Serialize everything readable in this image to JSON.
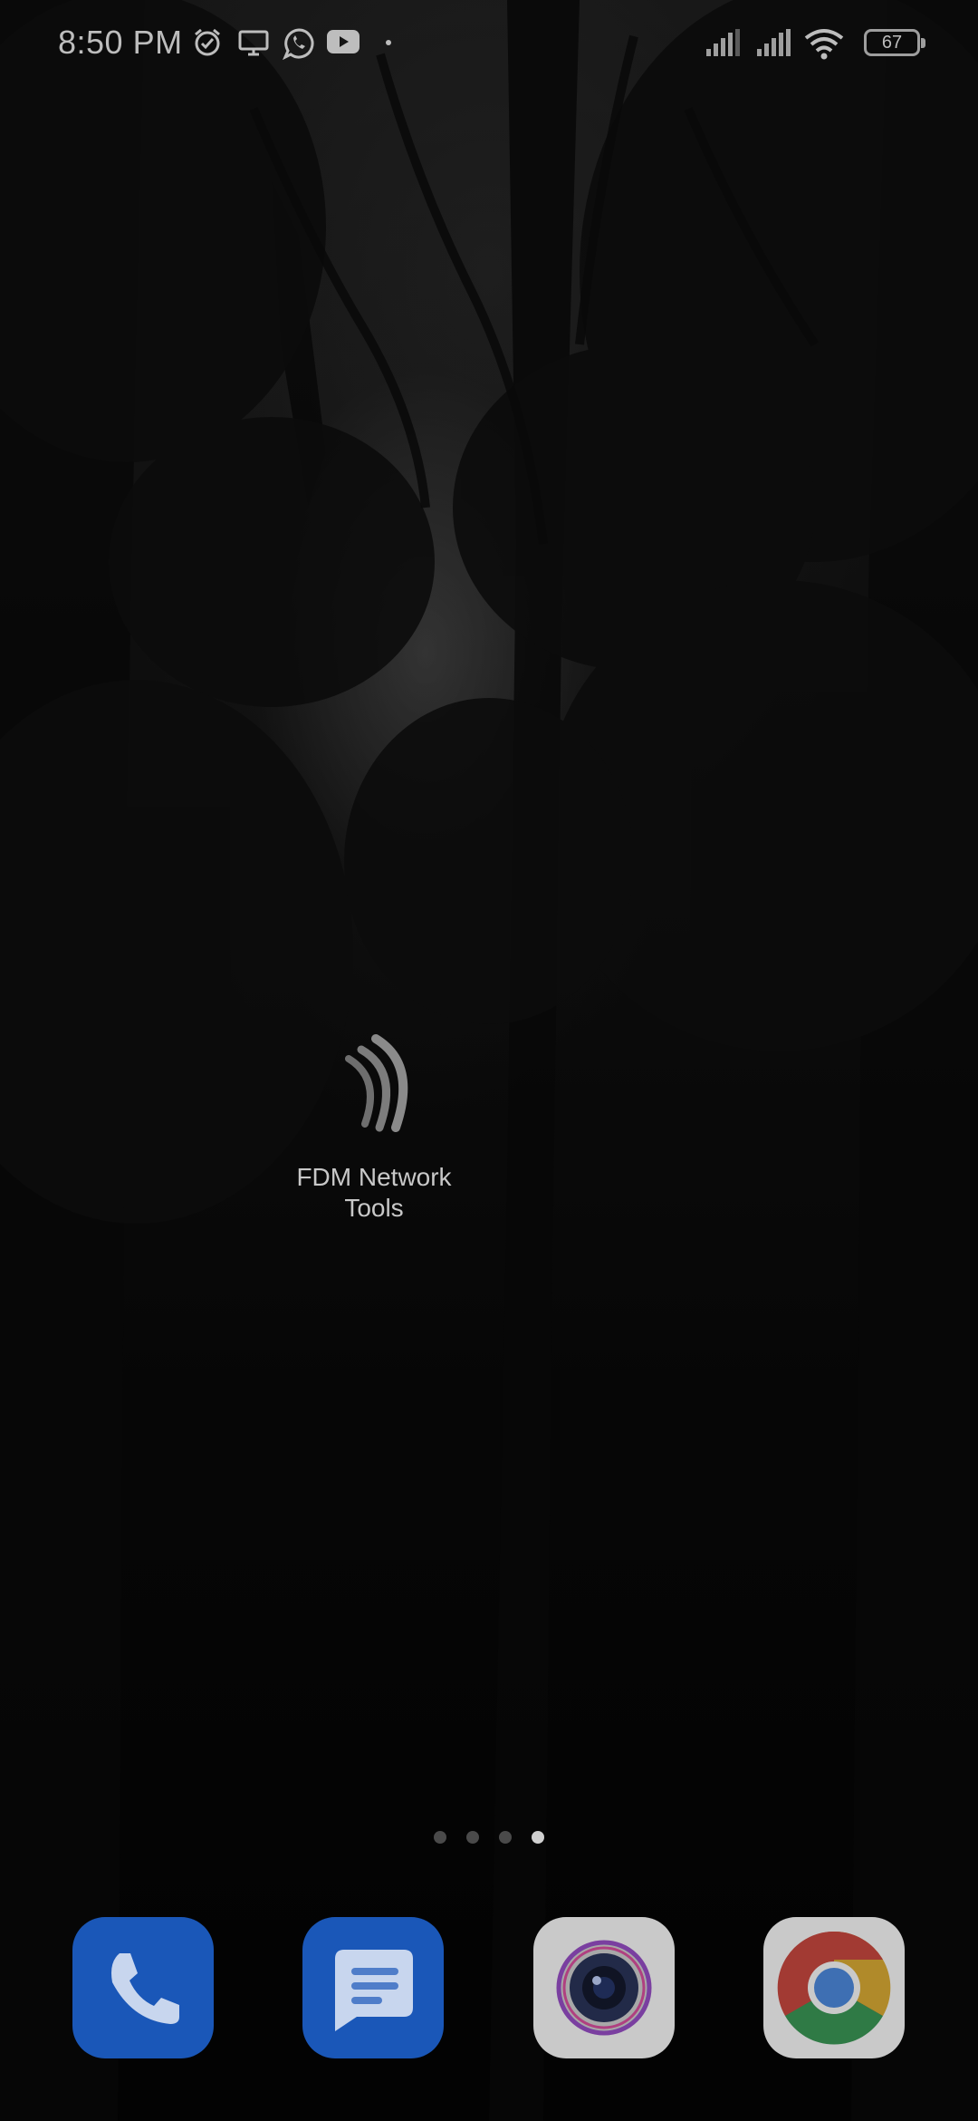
{
  "status_bar": {
    "time": "8:50 PM",
    "notification_icons": [
      "alarm-icon",
      "cast-screen-icon",
      "whatsapp-icon",
      "youtube-icon",
      "more-dot-icon"
    ],
    "system_icons": [
      "signal-sim1-icon",
      "signal-sim2-icon",
      "wifi-icon"
    ],
    "battery": "67"
  },
  "home": {
    "apps": [
      {
        "label": "FDM Network\nTools",
        "icon": "fdm-network-tools-icon"
      }
    ]
  },
  "page_indicator": {
    "count": 4,
    "active_index": 3
  },
  "dock": {
    "apps": [
      {
        "icon": "phone-icon"
      },
      {
        "icon": "messages-icon"
      },
      {
        "icon": "camera-icon"
      },
      {
        "icon": "chrome-icon"
      }
    ]
  },
  "colors": {
    "dock_blue": "#1a57b8",
    "dock_gray": "#c9c9c9",
    "status_text": "#bdbdbd"
  }
}
